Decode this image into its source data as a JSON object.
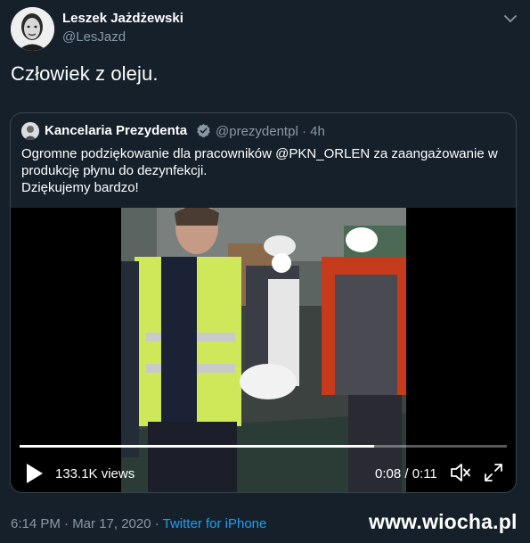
{
  "tweet": {
    "author_name": "Leszek Jażdżewski",
    "author_handle": "@LesJazd",
    "text": "Człowiek z oleju.",
    "avatar_icon": "profile-photo",
    "more_icon": "chevron-down-icon"
  },
  "quoted": {
    "author_name": "Kancelaria Prezydenta",
    "verified_icon": "verified-badge-icon",
    "handle": "@prezydentpl",
    "separator": "·",
    "age": "4h",
    "text_lines": [
      "Ogromne podziękowanie dla pracowników @PKN_ORLEN za zaangażowanie w",
      "produkcję płynu do dezynfekcji.",
      "Dziękujemy bardzo!"
    ],
    "video": {
      "progress": 0.727,
      "views": "133.1K views",
      "time": "0:08 / 0:11",
      "play_icon": "play-icon",
      "volume_icon": "volume-icon",
      "fullscreen_icon": "fullscreen-icon"
    }
  },
  "footer": {
    "timestamp": "6:14 PM · Mar 17, 2020 · ",
    "source": "Twitter for iPhone"
  },
  "watermark": "www.wiocha.pl",
  "colors": {
    "background": "#15202b",
    "border": "#38444d",
    "secondary_text": "#8899a6",
    "link": "#1da1f2",
    "verified": "#1da1f2"
  }
}
